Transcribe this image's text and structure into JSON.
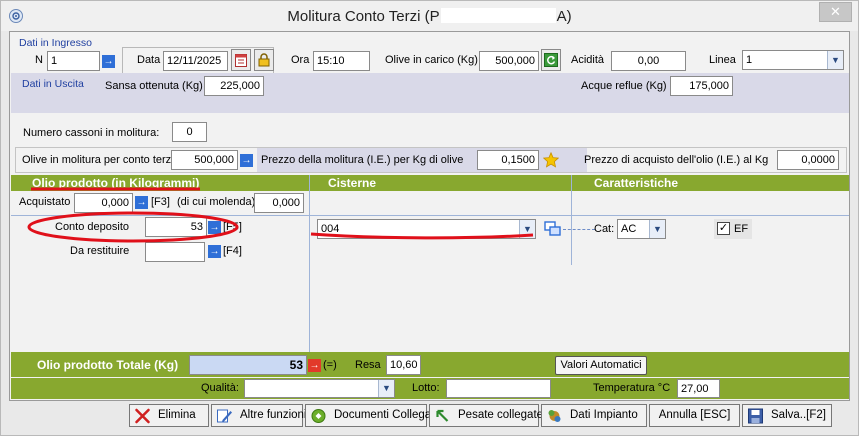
{
  "window": {
    "title_prefix": "Molitura Conto Terzi (P",
    "title_suffix": "A)",
    "close_glyph": "✕"
  },
  "dati_ingresso": {
    "section": "Dati in Ingresso",
    "n_label": "N",
    "n_value": "1",
    "data_label": "Data",
    "data_value": "12/11/2025",
    "ora_label": "Ora",
    "ora_value": "15:10",
    "olive_carico_label": "Olive in carico (Kg)",
    "olive_carico_value": "500,000",
    "acidita_label": "Acidità",
    "acidita_value": "0,00",
    "linea_label": "Linea",
    "linea_value": "1"
  },
  "dati_uscita": {
    "section": "Dati in Uscita",
    "sansa_label": "Sansa ottenuta (Kg)",
    "sansa_value": "225,000",
    "acque_label": "Acque reflue (Kg)",
    "acque_value": "175,000"
  },
  "molitura": {
    "cassoni_label": "Numero cassoni in molitura:",
    "cassoni_value": "0",
    "olive_terzi_label": "Olive in molitura per conto terzi:",
    "olive_terzi_value": "500,000",
    "prezzo_molitura_label": "Prezzo della molitura (I.E.) per Kg di olive",
    "prezzo_molitura_value": "0,1500",
    "prezzo_acquisto_label": "Prezzo di acquisto dell'olio (I.E.) al Kg",
    "prezzo_acquisto_value": "0,0000"
  },
  "headers": {
    "olio": "Olio prodotto (in Kilogrammi)",
    "cisterne": "Cisterne",
    "caratteristiche": "Caratteristiche"
  },
  "olio": {
    "acquistato_label": "Acquistato",
    "acquistato_value": "0,000",
    "f3": "[F3]",
    "molenda_label": "(di cui molenda)",
    "molenda_value": "0,000",
    "conto_label": "Conto deposito",
    "conto_value": "53",
    "f5": "[F5]",
    "restituire_label": "Da restituire",
    "restituire_value": "",
    "f4": "[F4]"
  },
  "cisterna": {
    "value": "004"
  },
  "caratteristiche": {
    "cat_label": "Cat:",
    "cat_value": "AC",
    "ef_label": "EF",
    "ef_checked": true
  },
  "totale": {
    "label": "Olio prodotto Totale (Kg)",
    "value": "53",
    "eq": "(=)",
    "resa_label": "Resa",
    "resa_value": "10,60",
    "valori_button": "Valori Automatici"
  },
  "footer_fields": {
    "qualita_label": "Qualità:",
    "qualita_value": "",
    "lotto_label": "Lotto:",
    "lotto_value": "",
    "temperatura_label": "Temperatura °C",
    "temperatura_value": "27,00"
  },
  "buttons": {
    "elimina": "Elimina",
    "altre": "Altre funzioni",
    "documenti": "Documenti Collegati",
    "pesate": "Pesate collegate",
    "dati_impianto": "Dati Impianto",
    "annulla": "Annulla [ESC]",
    "salva": "Salva..[F2]"
  },
  "colors": {
    "green": "#88a82f",
    "annotation_red": "#e0101a",
    "total_value_bg": "#cad9f3"
  },
  "icons": [
    "settings-icon",
    "arrow-right-icon",
    "calendar-icon",
    "lock-icon",
    "refresh-icon",
    "star-icon",
    "link-icon",
    "close-x-icon",
    "edit-icon",
    "documents-icon",
    "scale-icon",
    "plant-icon",
    "save-icon"
  ]
}
